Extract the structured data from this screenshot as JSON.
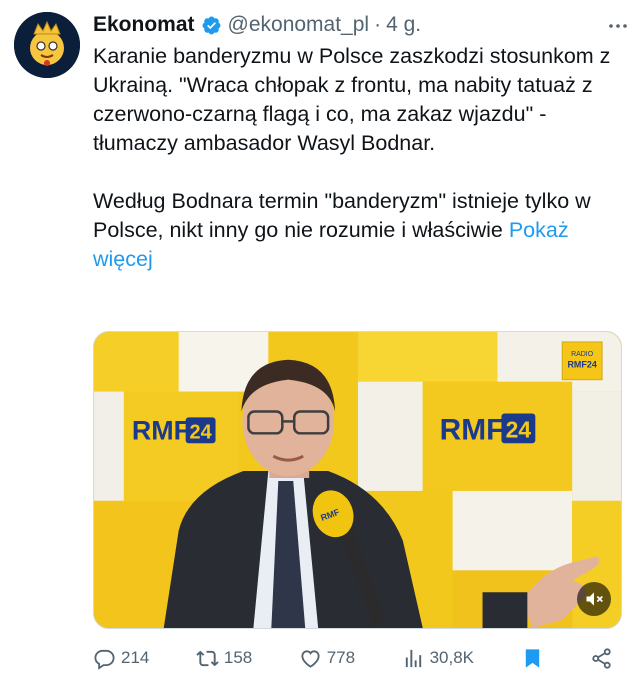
{
  "post": {
    "author": {
      "name": "Ekonomat",
      "handle": "@ekonomat_pl",
      "separator": "·",
      "time": "4 g."
    },
    "text": {
      "paragraph1": "Karanie banderyzmu w Polsce zaszkodzi stosunkom z Ukrainą. \"Wraca chłopak z frontu, ma nabity tatuaż z czerwono-czarną flagą i co, ma zakaz wjazdu\" - tłumaczy ambasador Wasyl Bodnar.",
      "paragraph2": "Według Bodnara termin \"banderyzm\" istnieje tylko w Polsce, nikt inny go nie rozumie i właściwie ",
      "show_more": "Pokaż więcej"
    },
    "media": {
      "logo_text": "RMF",
      "logo_number": "24",
      "small_logo_top": "RADIO",
      "small_logo_bottom": "RMF24",
      "colors": {
        "yellow": "#f2c81c",
        "blue": "#1c3a8c"
      }
    },
    "actions": {
      "replies": "214",
      "reposts": "158",
      "likes": "778",
      "views": "30,8K"
    },
    "colors": {
      "accent": "#1d9bf0",
      "muted": "#536471",
      "bookmark": "#1d9bf0"
    },
    "icons": [
      "verified-badge-icon",
      "more-icon",
      "reply-icon",
      "repost-icon",
      "like-icon",
      "views-icon",
      "bookmark-icon",
      "share-icon",
      "mute-icon"
    ]
  }
}
